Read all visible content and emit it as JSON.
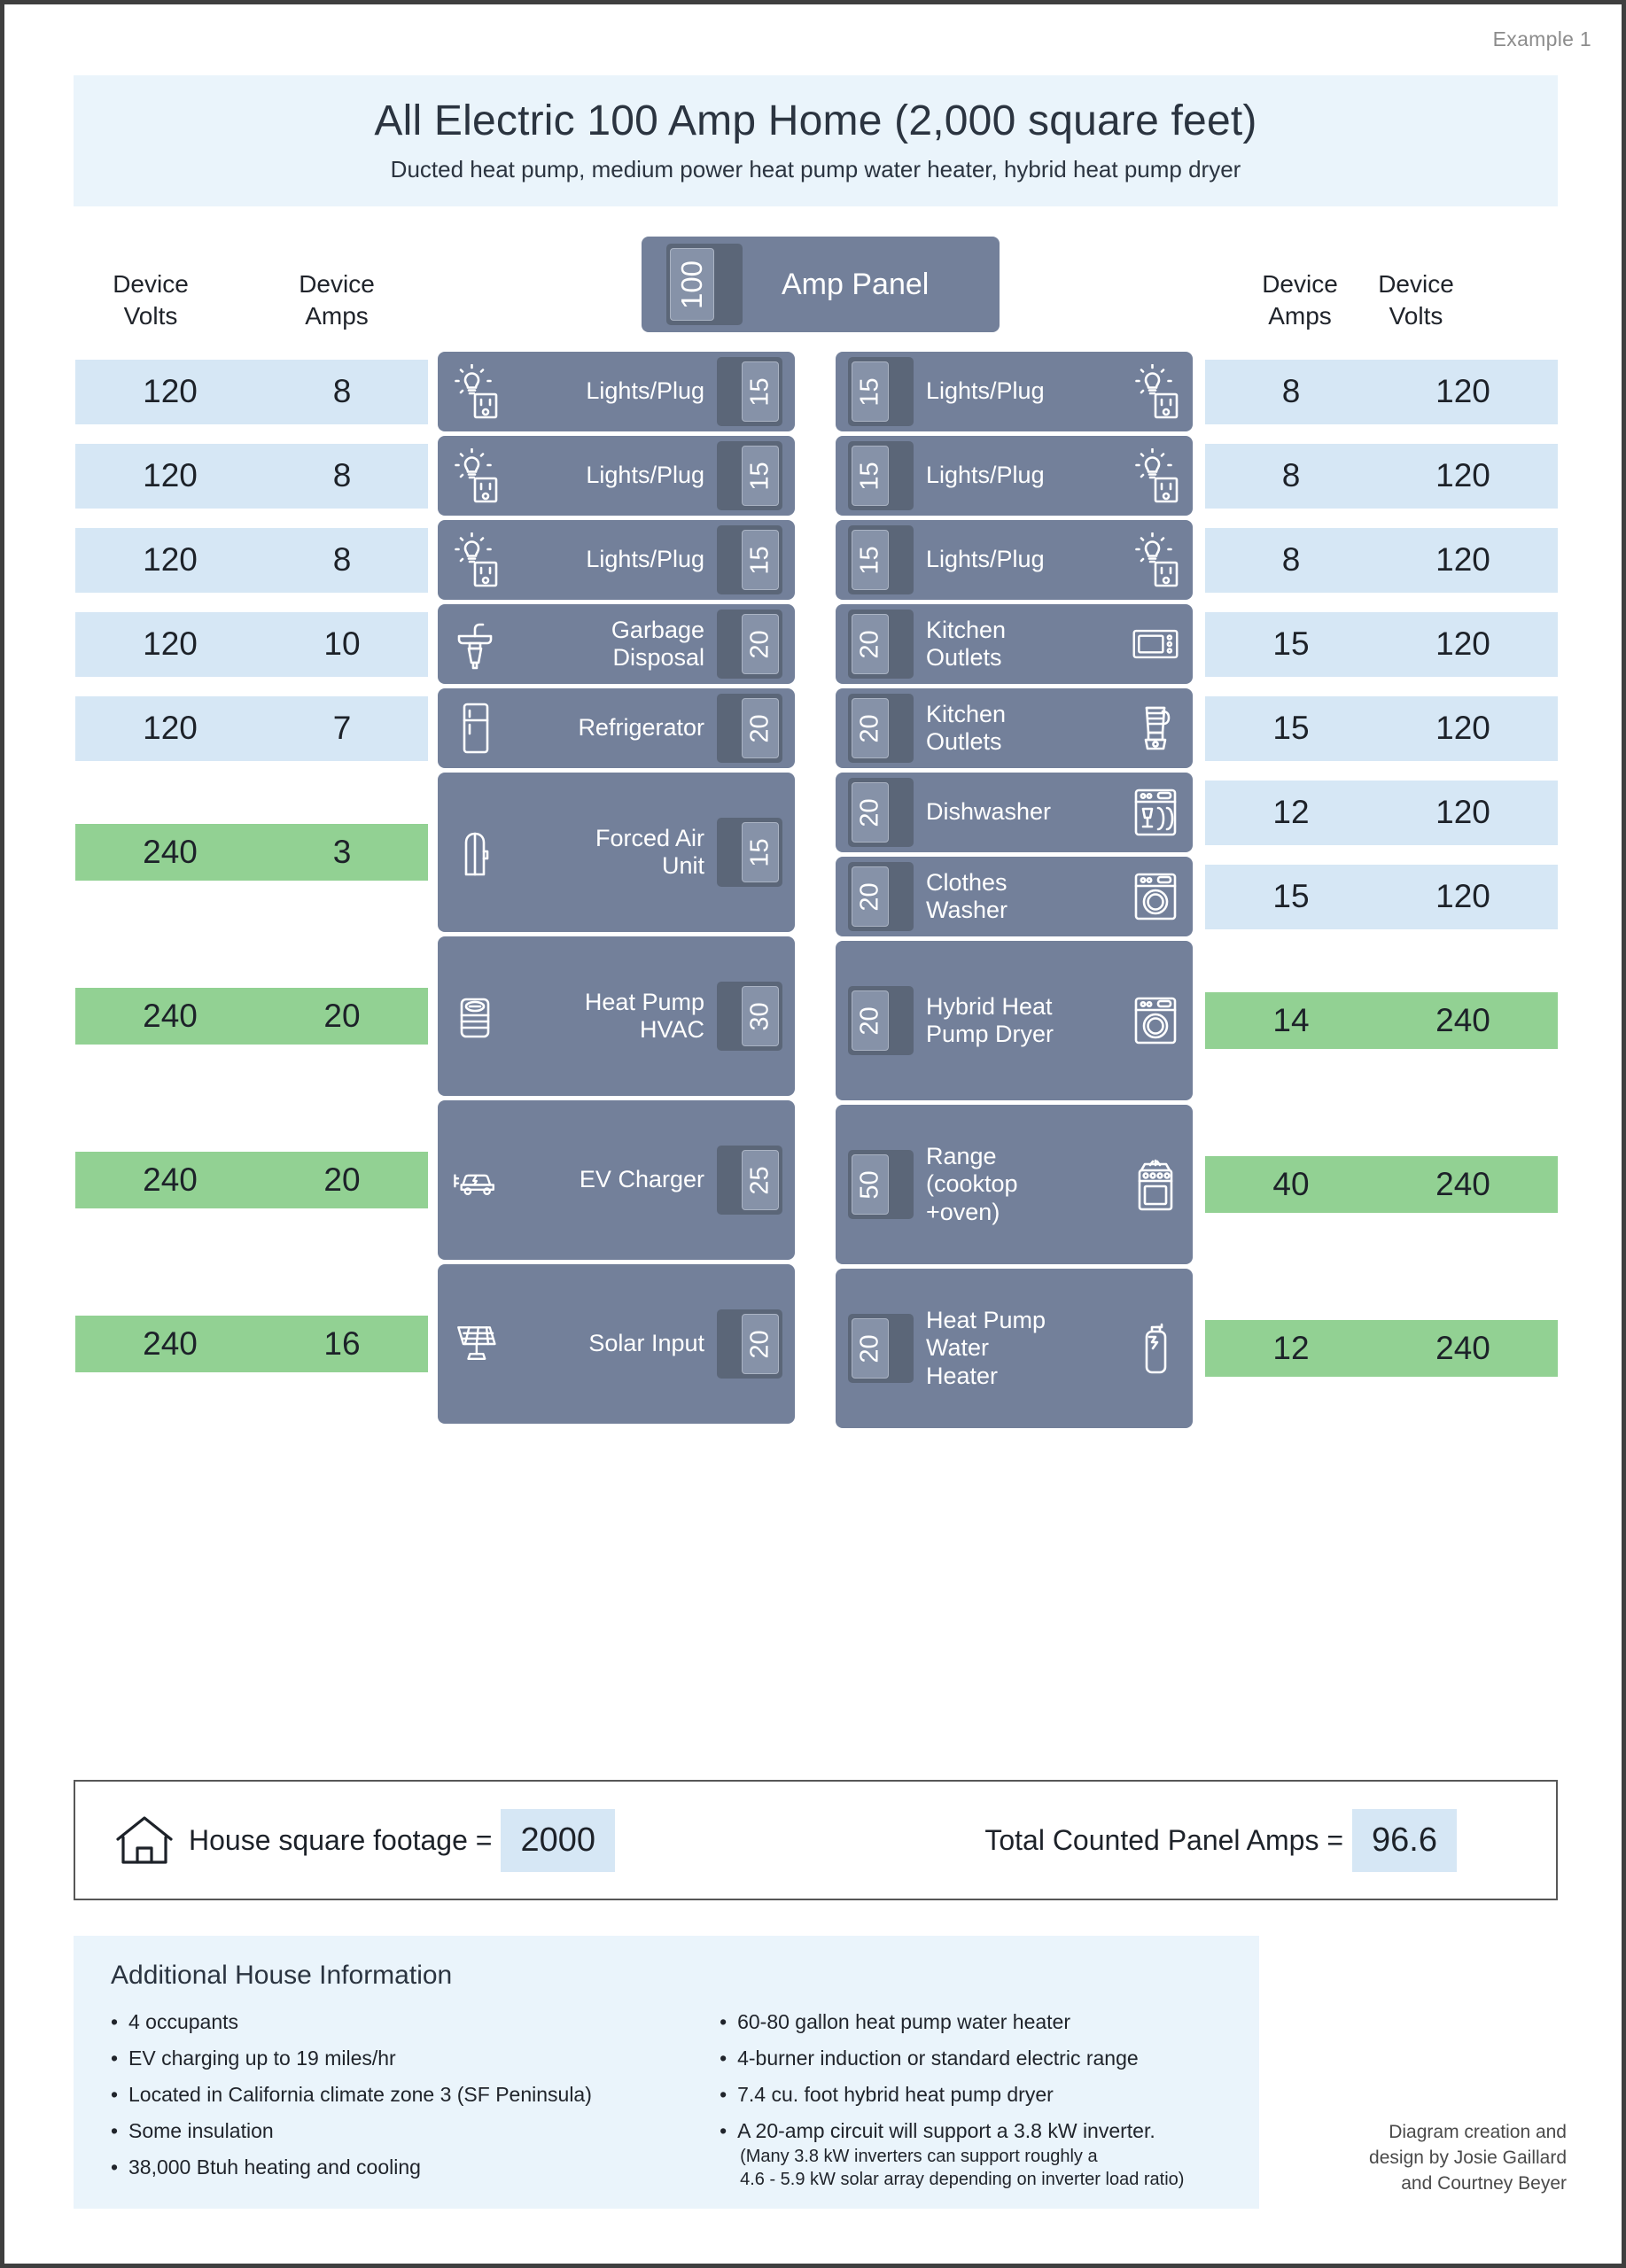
{
  "example_tag": "Example 1",
  "title": {
    "main": "All Electric 100 Amp Home (2,000 square feet)",
    "sub": "Ducted heat pump, medium power heat pump water heater, hybrid heat pump dryer"
  },
  "panel": {
    "amps": "100",
    "label": "Amp Panel"
  },
  "headers": {
    "left_volts": "Device\nVolts",
    "left_amps": "Device\nAmps",
    "right_amps": "Device\nAmps",
    "right_volts": "Device\nVolts"
  },
  "colors": {
    "card": "#73809a",
    "breaker_body": "#5b6678",
    "breaker_toggle": "#8692a8",
    "row_120v": "#d6e7f5",
    "row_240v": "#92d193",
    "band": "#eaf4fb",
    "border": "#3f3f3f"
  },
  "left_circuits": [
    {
      "label": "Lights/Plug",
      "breaker": "15",
      "icon": "lightbulb-outlet-icon",
      "height": 90,
      "volts": "120",
      "amps": "8",
      "kind": "120"
    },
    {
      "label": "Lights/Plug",
      "breaker": "15",
      "icon": "lightbulb-outlet-icon",
      "height": 90,
      "volts": "120",
      "amps": "8",
      "kind": "120"
    },
    {
      "label": "Lights/Plug",
      "breaker": "15",
      "icon": "lightbulb-outlet-icon",
      "height": 90,
      "volts": "120",
      "amps": "8",
      "kind": "120"
    },
    {
      "label": "Garbage\nDisposal",
      "breaker": "20",
      "icon": "garbage-disposal-icon",
      "height": 90,
      "volts": "120",
      "amps": "10",
      "kind": "120"
    },
    {
      "label": "Refrigerator",
      "breaker": "20",
      "icon": "refrigerator-icon",
      "height": 90,
      "volts": "120",
      "amps": "7",
      "kind": "120"
    },
    {
      "label": "Forced Air\nUnit",
      "breaker": "15",
      "icon": "forced-air-unit-icon",
      "height": 180,
      "volts": "240",
      "amps": "3",
      "kind": "240"
    },
    {
      "label": "Heat Pump\nHVAC",
      "breaker": "30",
      "icon": "heat-pump-icon",
      "height": 180,
      "volts": "240",
      "amps": "20",
      "kind": "240"
    },
    {
      "label": "EV Charger",
      "breaker": "25",
      "icon": "ev-charger-icon",
      "height": 180,
      "volts": "240",
      "amps": "20",
      "kind": "240"
    },
    {
      "label": "Solar Input",
      "breaker": "20",
      "icon": "solar-panel-icon",
      "height": 180,
      "volts": "240",
      "amps": "16",
      "kind": "240"
    }
  ],
  "right_circuits": [
    {
      "label": "Lights/Plug",
      "breaker": "15",
      "icon": "lightbulb-outlet-icon",
      "height": 90,
      "amps": "8",
      "volts": "120",
      "kind": "120"
    },
    {
      "label": "Lights/Plug",
      "breaker": "15",
      "icon": "lightbulb-outlet-icon",
      "height": 90,
      "amps": "8",
      "volts": "120",
      "kind": "120"
    },
    {
      "label": "Lights/Plug",
      "breaker": "15",
      "icon": "lightbulb-outlet-icon",
      "height": 90,
      "amps": "8",
      "volts": "120",
      "kind": "120"
    },
    {
      "label": "Kitchen\nOutlets",
      "breaker": "20",
      "icon": "microwave-icon",
      "height": 90,
      "amps": "15",
      "volts": "120",
      "kind": "120"
    },
    {
      "label": "Kitchen\nOutlets",
      "breaker": "20",
      "icon": "blender-icon",
      "height": 90,
      "amps": "15",
      "volts": "120",
      "kind": "120"
    },
    {
      "label": "Dishwasher",
      "breaker": "20",
      "icon": "dishwasher-icon",
      "height": 90,
      "amps": "12",
      "volts": "120",
      "kind": "120"
    },
    {
      "label": "Clothes\nWasher",
      "breaker": "20",
      "icon": "clothes-washer-icon",
      "height": 90,
      "amps": "15",
      "volts": "120",
      "kind": "120"
    },
    {
      "label": "Hybrid Heat\nPump Dryer",
      "breaker": "20",
      "icon": "dryer-icon",
      "height": 180,
      "amps": "14",
      "volts": "240",
      "kind": "240"
    },
    {
      "label": "Range\n(cooktop\n+oven)",
      "breaker": "50",
      "icon": "range-icon",
      "height": 180,
      "amps": "40",
      "volts": "240",
      "kind": "240"
    },
    {
      "label": "Heat Pump\nWater\nHeater",
      "breaker": "20",
      "icon": "water-heater-icon",
      "height": 180,
      "amps": "12",
      "volts": "240",
      "kind": "240"
    }
  ],
  "summary": {
    "sqft_label": "House square footage =",
    "sqft_value": "2000",
    "total_label": "Total Counted Panel Amps =",
    "total_value": "96.6"
  },
  "additional_info": {
    "title": "Additional House Information",
    "col1": [
      "4 occupants",
      "EV charging up to 19 miles/hr",
      "Located in California climate zone 3 (SF Peninsula)",
      "Some insulation",
      "38,000 Btuh heating and cooling"
    ],
    "col2": [
      "60-80 gallon heat pump water heater",
      "4-burner induction or standard electric range",
      "7.4 cu. foot hybrid heat pump dryer",
      "A 20-amp circuit will support a 3.8 kW inverter."
    ],
    "col2_sub": "(Many 3.8 kW inverters can support roughly a\n4.6 - 5.9 kW solar array depending on inverter load ratio)"
  },
  "credit": "Diagram creation and\ndesign by Josie Gaillard\nand Courtney Beyer"
}
